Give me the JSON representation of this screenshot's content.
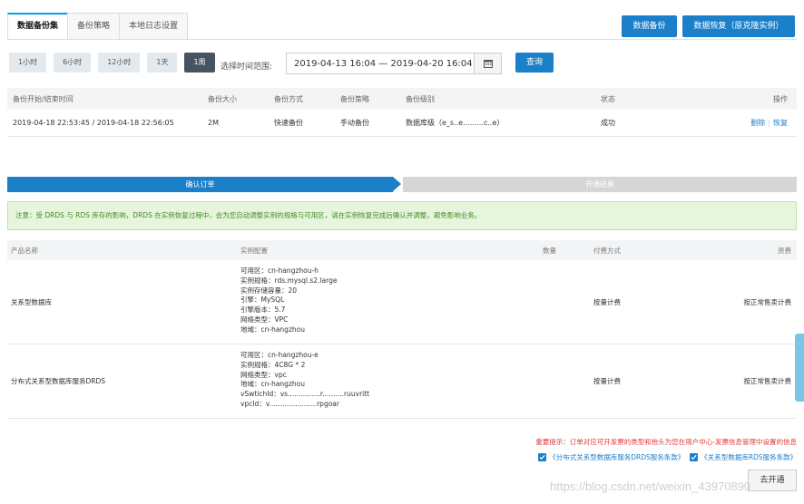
{
  "tabs": [
    "数据备份集",
    "备份策略",
    "本地日志设置"
  ],
  "top_buttons": {
    "backup": "数据备份",
    "restore": "数据恢复（原克隆实例）"
  },
  "range_buttons": [
    "1小时",
    "6小时",
    "12小时",
    "1天",
    "1周"
  ],
  "range_label": "选择时间范围:",
  "date_range": "2019-04-13 16:04  —  2019-04-20 16:04",
  "query_label": "查询",
  "backup_table": {
    "headers": [
      "备份开始/结束时间",
      "备份大小",
      "备份方式",
      "备份策略",
      "备份级别",
      "状态",
      "操作"
    ],
    "row": {
      "time": "2019-04-18 22:53:45 / 2019-04-18 22:56:05",
      "size": "2M",
      "method": "快速备份",
      "policy": "手动备份",
      "level": "数据库级（e_s..e.........c..e）",
      "status": "成功",
      "delete": "删除",
      "restore": "恢复"
    }
  },
  "steps": {
    "confirm": "确认订单",
    "result": "开通结果"
  },
  "notice": "注意：受 DRDS 与 RDS 库存的影响，DRDS 在实例恢复过程中，会为您自动调整实例的规格与可用区，请在实例恢复完成后确认并调整，避免影响业务。",
  "order_table": {
    "headers": [
      "产品名称",
      "实例配置",
      "数量",
      "付费方式",
      "资费"
    ],
    "rows": [
      {
        "name": "关系型数据库",
        "config": [
          "可用区：cn-hangzhou-h",
          "实例规格：rds.mysql.s2.large",
          "实例存储容量：20",
          "引擎：MySQL",
          "引擎版本：5.7",
          "网络类型：VPC",
          "地域：cn-hangzhou"
        ],
        "payment": "按量计费",
        "fee": "按正常售卖计费"
      },
      {
        "name": "分布式关系型数据库服务DRDS",
        "config": [
          "可用区：cn-hangzhou-e",
          "实例规格：4C8G * 2",
          "网络类型：vpc",
          "地域：cn-hangzhou",
          "vSwtichId：vs...............r..........ruuvritt",
          "vpcId：v......................rpgoar"
        ],
        "payment": "按量计费",
        "fee": "按正常售卖计费"
      }
    ]
  },
  "important_note": "重要提示：订单对应可开发票的类型和抬头为您在用户中心-发票信息管理中设置的信息",
  "agreements": [
    "《分布式关系型数据库服务DRDS服务条款》",
    "《关系型数据库RDS服务条款》"
  ],
  "pay_button": "去开通",
  "watermark": "https://blog.csdn.net/weixin_43970890",
  "colors": {
    "primary": "#1c7fc9",
    "notice_bg": "#e7f5dd",
    "notice_text": "#3f8b23",
    "warning": "#e03a3a"
  }
}
